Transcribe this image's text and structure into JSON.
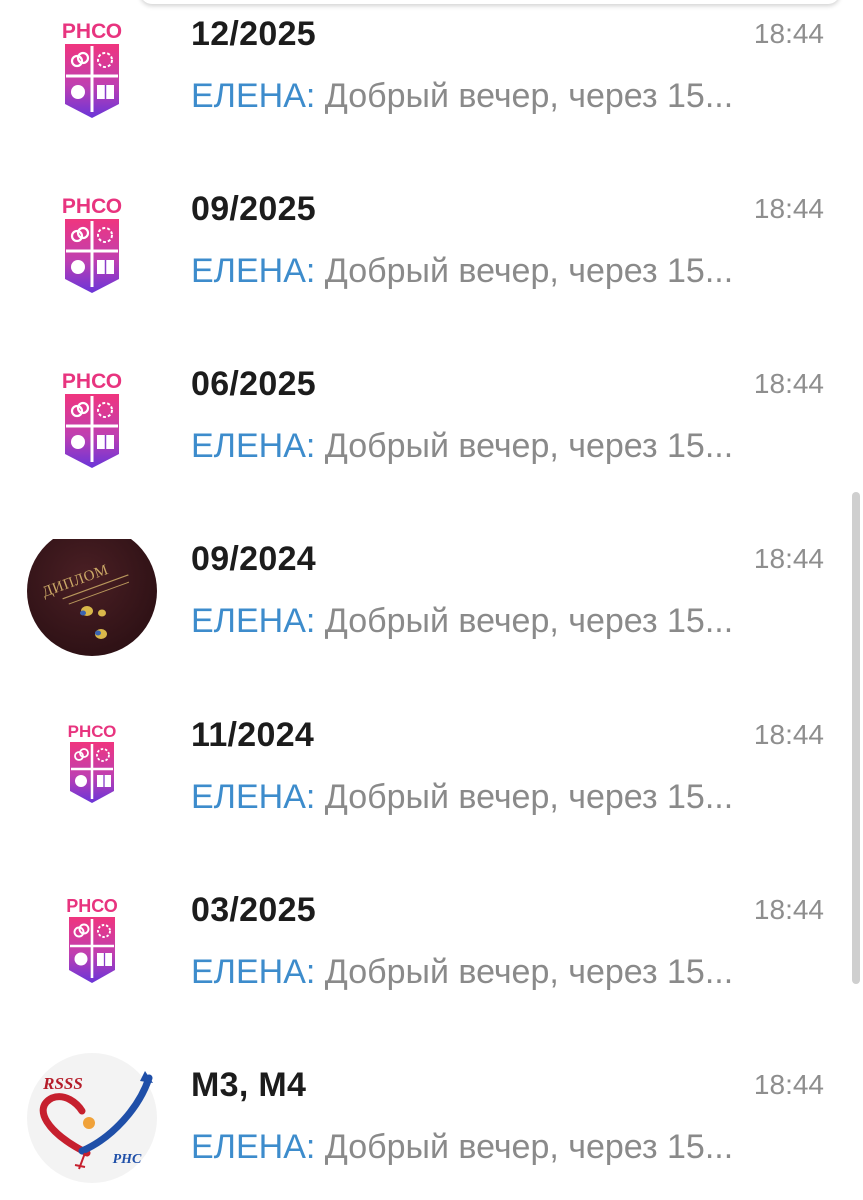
{
  "colors": {
    "title": "#1c1c1c",
    "sender": "#3d8ccc",
    "preview": "#8a8a8a",
    "time": "#8e8e8e",
    "logo_pink": "#e8347f",
    "logo_purple": "#6b34d8"
  },
  "chats": [
    {
      "title": "12/2025",
      "time": "18:44",
      "sender": "ЕЛЕНА:",
      "preview": " Добрый вечер, через 15...",
      "avatar": "rhso-logo",
      "avatar_text": "РНСО"
    },
    {
      "title": "09/2025",
      "time": "18:44",
      "sender": "ЕЛЕНА:",
      "preview": " Добрый вечер, через 15...",
      "avatar": "rhso-logo",
      "avatar_text": "РНСО"
    },
    {
      "title": "06/2025",
      "time": "18:44",
      "sender": "ЕЛЕНА:",
      "preview": " Добрый вечер, через 15...",
      "avatar": "rhso-logo",
      "avatar_text": "РНСО"
    },
    {
      "title": "09/2024",
      "time": "18:44",
      "sender": "ЕЛЕНА:",
      "preview": " Добрый вечер, через 15...",
      "avatar": "diploma-photo",
      "avatar_text": "ДИПЛОМ"
    },
    {
      "title": "11/2024",
      "time": "18:44",
      "sender": "ЕЛЕНА:",
      "preview": " Добрый вечер, через 15...",
      "avatar": "rhso-logo",
      "avatar_text": "РНСО"
    },
    {
      "title": "03/2025",
      "time": "18:44",
      "sender": "ЕЛЕНА:",
      "preview": " Добрый вечер, через 15...",
      "avatar": "rhso-logo",
      "avatar_text": "РНСО"
    },
    {
      "title": "М3, М4",
      "time": "18:44",
      "sender": "ЕЛЕНА:",
      "preview": " Добрый вечер, через 15...",
      "avatar": "rsss-logo",
      "avatar_text": "RSSS",
      "avatar_text_2": "РНС"
    }
  ]
}
